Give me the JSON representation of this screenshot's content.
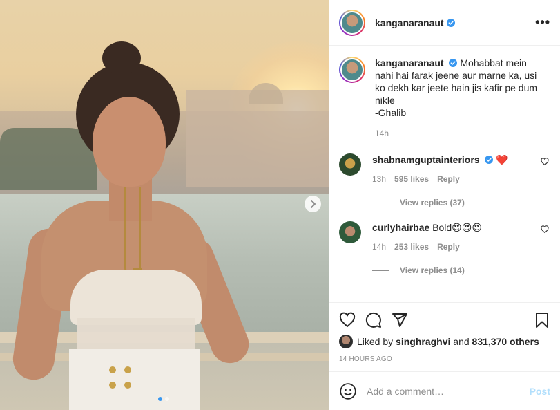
{
  "post": {
    "username": "kanganaranaut",
    "more_label": "•••"
  },
  "caption": {
    "username": "kanganaranaut",
    "text": "Mohabbat mein nahi hai farak jeene aur marne ka, usi ko dekh kar jeete hain jis kafir pe dum nikle",
    "attribution": "-Ghalib",
    "time": "14h"
  },
  "comments": [
    {
      "username": "shabnamguptainteriors",
      "text": "❤️",
      "verified": true,
      "time": "13h",
      "likes": "595 likes",
      "reply": "Reply",
      "view_replies": "View replies (37)"
    },
    {
      "username": "curlyhairbae",
      "text": "Bold😍😍😍",
      "verified": false,
      "time": "14h",
      "likes": "253 likes",
      "reply": "Reply",
      "view_replies": "View replies (14)"
    }
  ],
  "likes": {
    "prefix": "Liked by",
    "user": "singhraghvi",
    "conjunction": "and",
    "others": "831,370 others"
  },
  "post_time": "14 HOURS AGO",
  "add_comment": {
    "placeholder": "Add a comment…",
    "post_label": "Post"
  },
  "carousel": {
    "total": 2,
    "active": 1
  },
  "colors": {
    "verified_blue": "#3897f0",
    "heart_red": "#ed4956",
    "post_button_disabled": "#b2dffc"
  },
  "icons": [
    "heart-icon",
    "comment-icon",
    "share-icon",
    "bookmark-icon",
    "emoji-icon",
    "chevron-right-icon",
    "verified-icon",
    "more-icon"
  ]
}
